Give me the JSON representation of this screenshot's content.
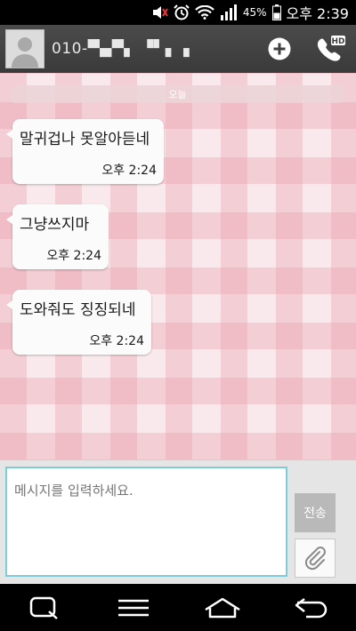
{
  "status_bar": {
    "battery_percent": "45%",
    "time": "오후 2:39",
    "icons": [
      "mute-icon",
      "alarm-icon",
      "wifi-icon",
      "signal-icon",
      "battery-icon"
    ]
  },
  "header": {
    "contact": "010-▀▄▀▖ ▝▘▖▗",
    "add_icon": "plus-circle-icon",
    "call_icon": "phone-hd-icon"
  },
  "chat": {
    "date_divider": "오늘",
    "messages": [
      {
        "text": "말귀겁나 못알아듣네",
        "time": "오후 2:24"
      },
      {
        "text": "그냥쓰지마",
        "time": "오후 2:24"
      },
      {
        "text": "도와줘도 징징되네",
        "time": "오후 2:24"
      }
    ]
  },
  "compose": {
    "placeholder": "메시지를 입력하세요.",
    "send_label": "전송",
    "attach_icon": "paperclip-icon"
  },
  "nav": {
    "icons": [
      "qslide-icon",
      "menu-icon",
      "home-icon",
      "back-icon"
    ]
  },
  "colors": {
    "header_bg": "#3f3f3f",
    "pink_check": "#f9e9ec",
    "input_border": "#7fcbd8",
    "send_bg": "#b9b9b9"
  }
}
